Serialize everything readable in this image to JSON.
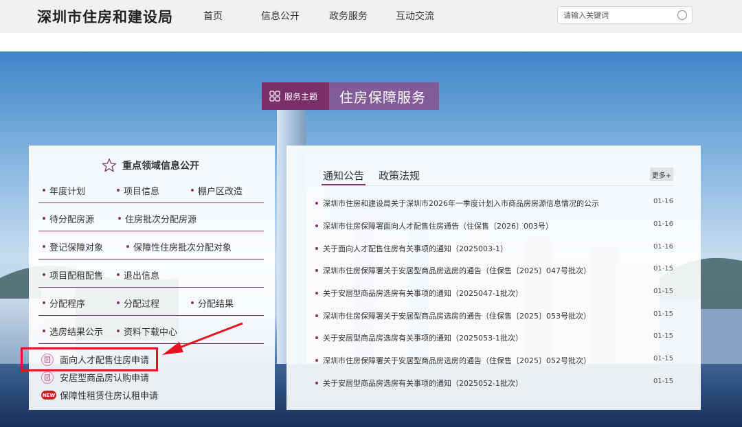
{
  "header": {
    "site_title": "深圳市住房和建设局",
    "nav": [
      "首页",
      "信息公开",
      "政务服务",
      "互动交流"
    ],
    "search_placeholder": "请输入关键词"
  },
  "banner": {
    "label": "服务主题",
    "title": "住房保障服务"
  },
  "left_panel": {
    "title": "重点领域信息公开",
    "rows": [
      [
        "年度计划",
        "项目信息",
        "棚户区改造"
      ],
      [
        "待分配房源",
        "住房批次分配房源"
      ],
      [
        "登记保障对象",
        "保障性住房批次分配对象"
      ],
      [
        "项目配租配售",
        "退出信息"
      ],
      [
        "分配程序",
        "分配过程",
        "分配结果"
      ],
      [
        "选房结果公示",
        "资料下载中心"
      ]
    ],
    "applications": [
      {
        "label": "面向人才配售住房申请",
        "icon": "document-icon"
      },
      {
        "label": "安居型商品房认购申请",
        "icon": "document-icon"
      },
      {
        "label": "保障性租赁住房认租申请",
        "icon": "new-badge",
        "badge": "NEW"
      }
    ]
  },
  "right_panel": {
    "tabs": [
      "通知公告",
      "政策法规"
    ],
    "active_tab": 0,
    "more_label": "更多+",
    "news": [
      {
        "title": "深圳市住房和建设局关于深圳市2026年一季度计划入市商品房房源信息情况的公示",
        "date": "01-16"
      },
      {
        "title": "深圳市住房保障署面向人才配售住房通告（住保售〔2026〕003号）",
        "date": "01-16"
      },
      {
        "title": "关于面向人才配售住房有关事项的通知（2025003-1）",
        "date": "01-16"
      },
      {
        "title": "深圳市住房保障署关于安居型商品房选房的通告（住保售〔2025〕047号批次）",
        "date": "01-15"
      },
      {
        "title": "关于安居型商品房选房有关事项的通知（2025047-1批次）",
        "date": "01-15"
      },
      {
        "title": "深圳市住房保障署关于安居型商品房选房的通告（住保售〔2025〕053号批次）",
        "date": "01-15"
      },
      {
        "title": "关于安居型商品房选房有关事项的通知（2025053-1批次）",
        "date": "01-15"
      },
      {
        "title": "深圳市住房保障署关于安居型商品房选房的通告（住保售〔2025〕052号批次）",
        "date": "01-15"
      },
      {
        "title": "关于安居型商品房选房有关事项的通知（2025052-1批次）",
        "date": "01-15"
      }
    ]
  },
  "colors": {
    "accent": "#7b3a6b",
    "banner_dark": "#7a2f68",
    "highlight": "#e5141f"
  }
}
